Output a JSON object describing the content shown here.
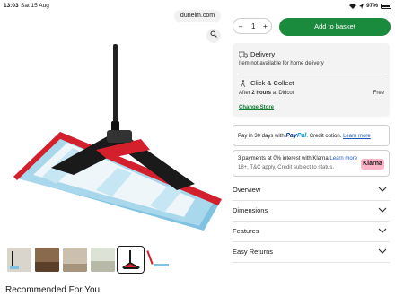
{
  "status_bar": {
    "time": "13:03",
    "date": "Sat 15 Aug",
    "battery": "97%"
  },
  "browser": {
    "url": "dunelm.com"
  },
  "gallery": {
    "zoom_icon": "zoom-icon",
    "thumbnail_count": 6,
    "active_thumbnail": 5
  },
  "purchase": {
    "qty_minus": "–",
    "qty_value": "1",
    "qty_plus": "+",
    "add_to_basket": "Add to basket"
  },
  "delivery": {
    "home_title": "Delivery",
    "home_status": "Item not available for home delivery",
    "collect_title": "Click & Collect",
    "collect_after": "After",
    "collect_hours": "2 hours",
    "collect_at": "at Didcot",
    "collect_price": "Free",
    "change_store": "Change Store"
  },
  "paypal": {
    "text_before": "Pay in 30 days with",
    "brand_pay": "Pay",
    "brand_pal": "Pal",
    "text_after": ". Credit option.",
    "link": "Learn more"
  },
  "klarna": {
    "line1": "3 payments at 0% interest with Klarna",
    "line1_link": "Learn more",
    "line2": "18+, T&C apply, Credit subject to status.",
    "logo": "Klarna"
  },
  "accordions": [
    {
      "label": "Overview"
    },
    {
      "label": "Dimensions"
    },
    {
      "label": "Features"
    },
    {
      "label": "Easy Returns"
    }
  ],
  "recommended": {
    "title": "Recommended For You"
  },
  "colors": {
    "brand_green": "#1a8a3c",
    "link_blue": "#1a56b3",
    "mop_red": "#d41f2c",
    "mop_blue": "#7fc3e0"
  }
}
